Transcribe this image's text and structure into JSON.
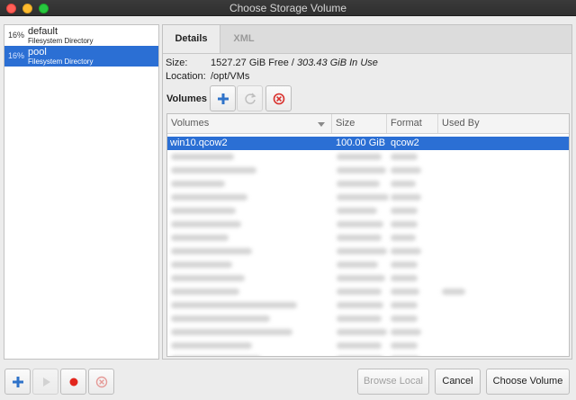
{
  "window": {
    "title": "Choose Storage Volume"
  },
  "pools": [
    {
      "usage": "16%",
      "name": "default",
      "type": "Filesystem Directory",
      "selected": false
    },
    {
      "usage": "16%",
      "name": "pool",
      "type": "Filesystem Directory",
      "selected": true
    }
  ],
  "tabs": {
    "details": "Details",
    "xml": "XML"
  },
  "details": {
    "size_label": "Size:",
    "free": "1527.27 GiB Free /",
    "in_use": "303.43 GiB In Use",
    "location_label": "Location:",
    "location": "/opt/VMs"
  },
  "volumes": {
    "label": "Volumes",
    "columns": {
      "name": "Volumes",
      "size": "Size",
      "format": "Format",
      "used_by": "Used By"
    },
    "rows": [
      {
        "name": "win10.qcow2",
        "size": "100.00 GiB",
        "format": "qcow2",
        "used_by": ""
      }
    ]
  },
  "buttons": {
    "browse_local": "Browse Local",
    "cancel": "Cancel",
    "choose_volume": "Choose Volume"
  },
  "colors": {
    "selection": "#2b6fd4",
    "add_icon": "#2f73c9",
    "delete_icon": "#d9302c",
    "record_icon": "#e2261d"
  }
}
